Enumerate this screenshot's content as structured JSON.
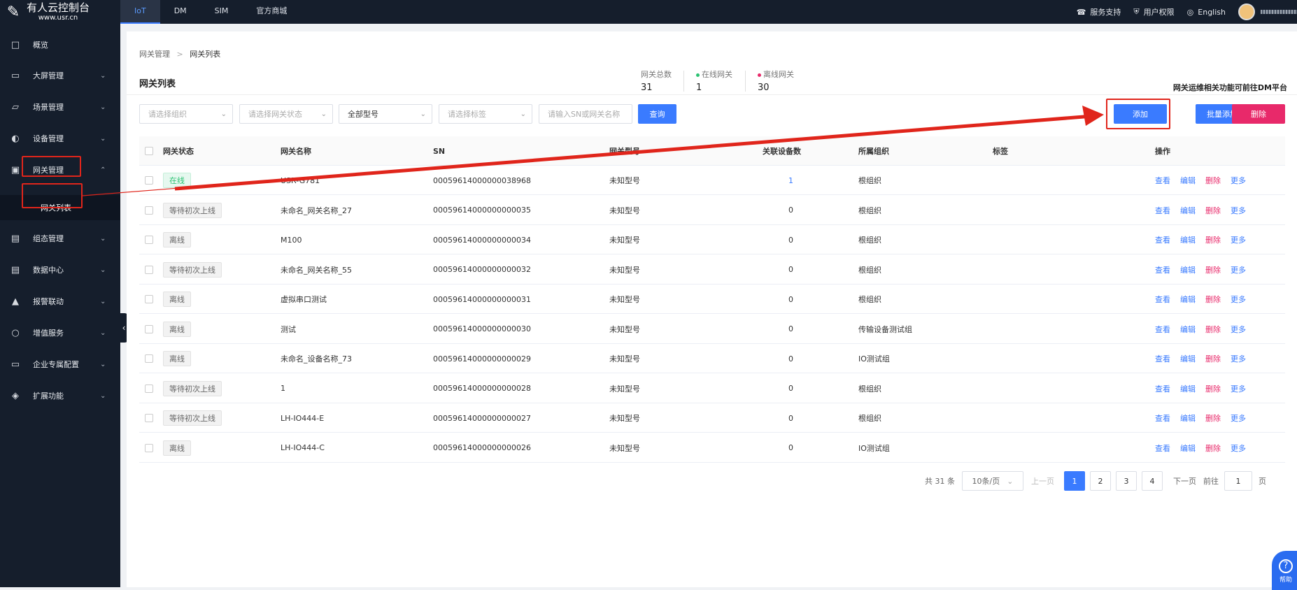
{
  "app": {
    "title": "有人云控制台",
    "site": "www.usr.cn"
  },
  "topnav": {
    "items": [
      "IoT",
      "DM",
      "SIM",
      "官方商城"
    ]
  },
  "topright": {
    "support": "服务支持",
    "perms": "用户权限",
    "lang": "English"
  },
  "sidebar": {
    "items": [
      {
        "label": "概览",
        "icon": "overview-icon",
        "has_chevron": false
      },
      {
        "label": "大屏管理",
        "icon": "monitor-icon",
        "has_chevron": true
      },
      {
        "label": "场景管理",
        "icon": "cube-icon",
        "has_chevron": true
      },
      {
        "label": "设备管理",
        "icon": "pie-icon",
        "has_chevron": true
      },
      {
        "label": "网关管理",
        "icon": "gateway-icon",
        "has_chevron": true
      },
      {
        "label": "组态管理",
        "icon": "image-icon",
        "has_chevron": true
      },
      {
        "label": "数据中心",
        "icon": "bar-chart-icon",
        "has_chevron": true
      },
      {
        "label": "报警联动",
        "icon": "alarm-icon",
        "has_chevron": true
      },
      {
        "label": "增值服务",
        "icon": "coin-icon",
        "has_chevron": true
      },
      {
        "label": "企业专属配置",
        "icon": "screen-icon",
        "has_chevron": true
      },
      {
        "label": "扩展功能",
        "icon": "layers-icon",
        "has_chevron": true
      }
    ],
    "subitem": "网关列表"
  },
  "breadcrumb": {
    "parent": "网关管理",
    "sep": ">",
    "current": "网关列表"
  },
  "page_title": "网关列表",
  "stats": [
    {
      "label": "网关总数",
      "value": "31"
    },
    {
      "label": "在线网关",
      "value": "1",
      "color": "#2bc272"
    },
    {
      "label": "离线网关",
      "value": "30",
      "color": "#e8296a"
    }
  ],
  "hint": "网关运维相关功能可前往DM平台",
  "filters": {
    "org": "请选择组织",
    "status": "请选择网关状态",
    "model": "全部型号",
    "tag": "请选择标签",
    "search_placeholder": "请输入SN或网关名称",
    "query": "查询"
  },
  "buttons": {
    "add": "添加",
    "batch_add": "批量添加",
    "delete": "删除"
  },
  "table": {
    "headers": [
      "网关状态",
      "网关名称",
      "SN",
      "网关型号",
      "关联设备数",
      "所属组织",
      "标签",
      "操作"
    ],
    "actions": [
      "查看",
      "编辑",
      "删除",
      "更多"
    ],
    "rows": [
      {
        "status": "在线",
        "kind": "on",
        "name": "USR-G781",
        "sn": "00059614000000038968",
        "model": "未知型号",
        "devices": "1",
        "org": "根组织"
      },
      {
        "status": "等待初次上线",
        "kind": "wait",
        "name": "未命名_网关名称_27",
        "sn": "00059614000000000035",
        "model": "未知型号",
        "devices": "0",
        "org": "根组织"
      },
      {
        "status": "离线",
        "kind": "off",
        "name": "M100",
        "sn": "00059614000000000034",
        "model": "未知型号",
        "devices": "0",
        "org": "根组织"
      },
      {
        "status": "等待初次上线",
        "kind": "wait",
        "name": "未命名_网关名称_55",
        "sn": "00059614000000000032",
        "model": "未知型号",
        "devices": "0",
        "org": "根组织"
      },
      {
        "status": "离线",
        "kind": "off",
        "name": "虚拟串口测试",
        "sn": "00059614000000000031",
        "model": "未知型号",
        "devices": "0",
        "org": "根组织"
      },
      {
        "status": "离线",
        "kind": "off",
        "name": "测试",
        "sn": "00059614000000000030",
        "model": "未知型号",
        "devices": "0",
        "org": "传输设备测试组"
      },
      {
        "status": "离线",
        "kind": "off",
        "name": "未命名_设备名称_73",
        "sn": "00059614000000000029",
        "model": "未知型号",
        "devices": "0",
        "org": "IO测试组"
      },
      {
        "status": "等待初次上线",
        "kind": "wait",
        "name": "1",
        "sn": "00059614000000000028",
        "model": "未知型号",
        "devices": "0",
        "org": "根组织"
      },
      {
        "status": "等待初次上线",
        "kind": "wait",
        "name": "LH-IO444-E",
        "sn": "00059614000000000027",
        "model": "未知型号",
        "devices": "0",
        "org": "根组织"
      },
      {
        "status": "离线",
        "kind": "off",
        "name": "LH-IO444-C",
        "sn": "00059614000000000026",
        "model": "未知型号",
        "devices": "0",
        "org": "IO测试组"
      }
    ]
  },
  "pagination": {
    "total": "共 31 条",
    "page_size": "10条/页",
    "prev": "上一页",
    "pages": [
      "1",
      "2",
      "3",
      "4"
    ],
    "next": "下一页",
    "goto": "前往",
    "goto_value": "1",
    "page_unit": "页"
  },
  "help": "帮助",
  "colors": {
    "accent": "#3a7bff",
    "danger": "#e8296a",
    "annotation": "#e0251b"
  }
}
